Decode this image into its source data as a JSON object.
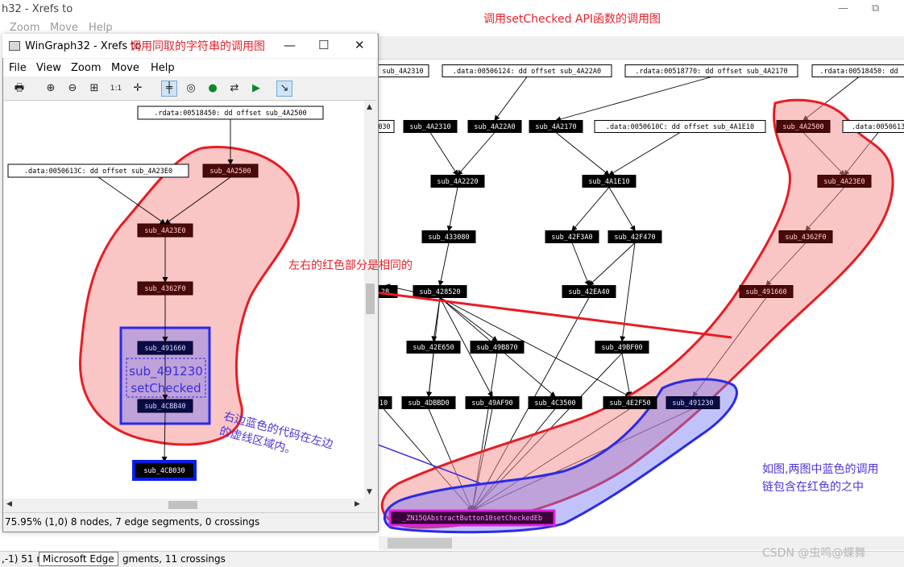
{
  "background_window": {
    "title": "h32 - Xrefs to",
    "menu": [
      "Zoom",
      "Move",
      "Help"
    ],
    "status_left": ",-1)  51 r",
    "status_right": "gments, 11 crossings",
    "taskbar_tooltip": "Microsoft Edge",
    "window_controls": [
      "—",
      "⧉"
    ]
  },
  "dialog": {
    "title": "WinGraph32 - Xrefs to",
    "menu": [
      "File",
      "View",
      "Zoom",
      "Move",
      "Help"
    ],
    "toolbar_icons": [
      "print-icon",
      "zoom-in-icon",
      "zoom-out-icon",
      "fit-icon",
      "zoom-100-icon",
      "center-icon",
      "layout-icon",
      "graph-icon",
      "node-icon",
      "edge-icon",
      "nav-icon",
      "pointer-icon"
    ],
    "status": "75.95%  (1,0)  8 nodes, 7 edge segments, 0 crossings",
    "buttons": [
      "—",
      "☐",
      "✕"
    ]
  },
  "annotations": {
    "title_right": "调用setChecked API函数的调用图",
    "title_left": "调用同取的字符串的调用图",
    "same_red": "左右的红色部分是相同的",
    "right_blue_line1": "右边蓝色的代码在左边",
    "right_blue_line2": "的虚线区域内。",
    "figure_note_line1": "如图,两图中蓝色的调用",
    "figure_note_line2": "链包含在红色的之中",
    "watermark": "CSDN @虫鸣@蝶舞"
  },
  "left_graph": {
    "nodes": [
      {
        "id": "L_rdata",
        "label": ".rdata:00518450: dd offset sub_4A2500",
        "style": "white"
      },
      {
        "id": "L_data",
        "label": ".data:0050613C: dd offset sub_4A23E0",
        "style": "white"
      },
      {
        "id": "L_4A2500",
        "label": "sub_4A2500",
        "style": "red"
      },
      {
        "id": "L_4A23E0",
        "label": "sub_4A23E0",
        "style": "red"
      },
      {
        "id": "L_4362F0",
        "label": "sub_4362F0",
        "style": "red"
      },
      {
        "id": "L_491660",
        "label": "sub_491660",
        "style": "blue"
      },
      {
        "id": "L_4CBB40",
        "label": "sub_4CBB40",
        "style": "blue"
      },
      {
        "id": "L_4CB030",
        "label": "sub_4CB030",
        "style": "bluebox"
      }
    ],
    "edges": [
      [
        "L_rdata",
        "L_4A2500"
      ],
      [
        "L_4A2500",
        "L_4A23E0"
      ],
      [
        "L_data",
        "L_4A23E0"
      ],
      [
        "L_4A23E0",
        "L_4362F0"
      ],
      [
        "L_4362F0",
        "L_491660"
      ],
      [
        "L_491660",
        "L_4CBB40"
      ],
      [
        "L_4CBB40",
        "L_4CB030"
      ]
    ],
    "dashed_box_line1": "sub_491230",
    "dashed_box_line2": "setChecked"
  },
  "right_graph": {
    "nodes": [
      {
        "id": "R_top1",
        "label": "sub_4A2310",
        "style": "white"
      },
      {
        "id": "R_top2",
        "label": ".data:00506124: dd offset sub_4A22A0",
        "style": "white"
      },
      {
        "id": "R_top3",
        "label": ".rdata:00518770: dd offset sub_4A2170",
        "style": "white"
      },
      {
        "id": "R_top4",
        "label": ".rdata:00518450: dd",
        "style": "white"
      },
      {
        "id": "R_030",
        "label": "030",
        "style": "white"
      },
      {
        "id": "R_4A2310",
        "label": "sub_4A2310",
        "style": "black"
      },
      {
        "id": "R_4A22A0",
        "label": "sub_4A22A0",
        "style": "black"
      },
      {
        "id": "R_4A2170",
        "label": "sub_4A2170",
        "style": "black"
      },
      {
        "id": "R_data10C",
        "label": ".data:0050610C: dd offset sub_4A1E10",
        "style": "white"
      },
      {
        "id": "R_4A2500",
        "label": "sub_4A2500",
        "style": "red"
      },
      {
        "id": "R_data613",
        "label": ".data:0050613",
        "style": "white"
      },
      {
        "id": "R_4A2220",
        "label": "sub_4A2220",
        "style": "black"
      },
      {
        "id": "R_4A1E10",
        "label": "sub_4A1E10",
        "style": "black"
      },
      {
        "id": "R_4A23E0",
        "label": "sub_4A23E0",
        "style": "red"
      },
      {
        "id": "R_433080",
        "label": "sub_433080",
        "style": "black"
      },
      {
        "id": "R_42F3A0",
        "label": "sub_42F3A0",
        "style": "black"
      },
      {
        "id": "R_42F470",
        "label": "sub_42F470",
        "style": "black"
      },
      {
        "id": "R_4362F0",
        "label": "sub_4362F0",
        "style": "red"
      },
      {
        "id": "R_28x",
        "label": "28",
        "style": "black"
      },
      {
        "id": "R_428520",
        "label": "sub_428520",
        "style": "black"
      },
      {
        "id": "R_42EA40",
        "label": "sub_42EA40",
        "style": "black"
      },
      {
        "id": "R_491660",
        "label": "sub_491660",
        "style": "red"
      },
      {
        "id": "R_42E650",
        "label": "sub_42E650",
        "style": "black"
      },
      {
        "id": "R_49B870",
        "label": "sub_49B870",
        "style": "black"
      },
      {
        "id": "R_49BF00",
        "label": "sub_49BF00",
        "style": "black"
      },
      {
        "id": "R_10x",
        "label": "10",
        "style": "black"
      },
      {
        "id": "R_4DBBD0",
        "label": "sub_4DBBD0",
        "style": "black"
      },
      {
        "id": "R_49AF90",
        "label": "sub_49AF90",
        "style": "black"
      },
      {
        "id": "R_4C3500",
        "label": "sub_4C3500",
        "style": "black"
      },
      {
        "id": "R_4E2F50",
        "label": "sub_4E2F50",
        "style": "black"
      },
      {
        "id": "R_491230",
        "label": "sub_491230",
        "style": "blue"
      },
      {
        "id": "R_target",
        "label": "_ZN15QAbstractButton10setCheckedEb",
        "style": "magenta"
      }
    ],
    "edges": [
      [
        "R_top2",
        "R_4A22A0"
      ],
      [
        "R_top3",
        "R_4A2170"
      ],
      [
        "R_top4",
        "R_4A2500"
      ],
      [
        "R_4A2310",
        "R_4A2220"
      ],
      [
        "R_4A22A0",
        "R_4A2220"
      ],
      [
        "R_4A2220",
        "R_433080"
      ],
      [
        "R_433080",
        "R_428520"
      ],
      [
        "R_4A2170",
        "R_4A1E10"
      ],
      [
        "R_data10C",
        "R_4A1E10"
      ],
      [
        "R_4A1E10",
        "R_42F3A0"
      ],
      [
        "R_4A1E10",
        "R_42F470"
      ],
      [
        "R_42F3A0",
        "R_42EA40"
      ],
      [
        "R_42F470",
        "R_42EA40"
      ],
      [
        "R_42F470",
        "R_49BF00"
      ],
      [
        "R_42EA40",
        "R_target"
      ],
      [
        "R_4A2500",
        "R_4A23E0"
      ],
      [
        "R_data613",
        "R_4A23E0"
      ],
      [
        "R_4A23E0",
        "R_4362F0"
      ],
      [
        "R_4362F0",
        "R_491660"
      ],
      [
        "R_491660",
        "R_491230"
      ],
      [
        "R_491230",
        "R_target"
      ],
      [
        "R_428520",
        "R_42E650"
      ],
      [
        "R_428520",
        "R_49B870"
      ],
      [
        "R_428520",
        "R_4DBBD0"
      ],
      [
        "R_428520",
        "R_49AF90"
      ],
      [
        "R_428520",
        "R_4C3500"
      ],
      [
        "R_428520",
        "R_4E2F50"
      ],
      [
        "R_428520",
        "R_28x"
      ],
      [
        "R_42E650",
        "R_4DBBD0"
      ],
      [
        "R_49BF00",
        "R_4E2F50"
      ],
      [
        "R_4DBBD0",
        "R_target"
      ],
      [
        "R_49AF90",
        "R_target"
      ],
      [
        "R_4C3500",
        "R_target"
      ],
      [
        "R_4E2F50",
        "R_target"
      ],
      [
        "R_10x",
        "R_target"
      ],
      [
        "R_49BF00",
        "R_target"
      ],
      [
        "R_49B870",
        "R_target"
      ]
    ]
  }
}
